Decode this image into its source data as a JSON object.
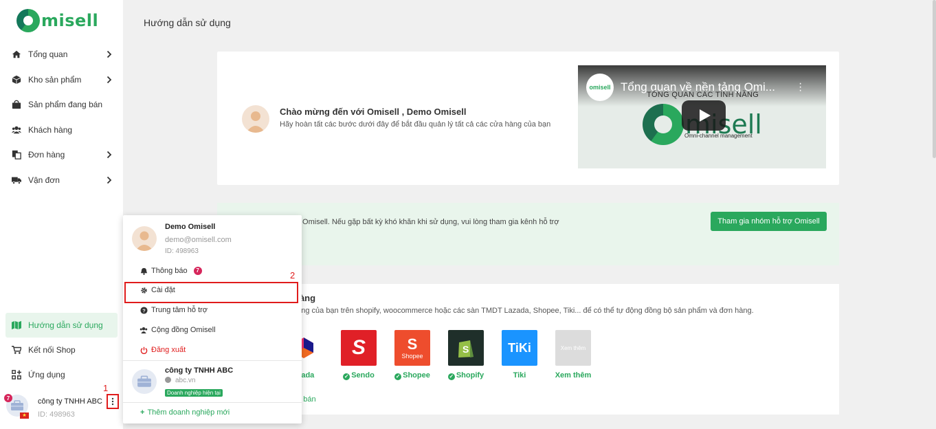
{
  "brand": {
    "logo_text": "misell",
    "accent": "#2aa85d"
  },
  "sidebar": {
    "items": [
      {
        "label": "Tổng quan",
        "icon": "home-icon",
        "has_submenu": true
      },
      {
        "label": "Kho sản phẩm",
        "icon": "box-icon",
        "has_submenu": true
      },
      {
        "label": "Sản phẩm đang bán",
        "icon": "bag-icon",
        "has_submenu": false
      },
      {
        "label": "Khách hàng",
        "icon": "users-icon",
        "has_submenu": false
      },
      {
        "label": "Đơn hàng",
        "icon": "orders-icon",
        "has_submenu": true
      },
      {
        "label": "Vận đơn",
        "icon": "truck-icon",
        "has_submenu": true
      }
    ],
    "bottom_items": [
      {
        "label": "Hướng dẫn sử dụng",
        "icon": "map-icon",
        "active": true
      },
      {
        "label": "Kết nối Shop",
        "icon": "cart-icon",
        "active": false
      },
      {
        "label": "Ứng dụng",
        "icon": "apps-icon",
        "active": false
      }
    ],
    "company": {
      "name": "công ty TNHH ABC",
      "id_text": "ID: 498963",
      "notification_count": "7",
      "flag": "★"
    },
    "marker": "1"
  },
  "main": {
    "page_title": "Hướng dẫn sử dụng",
    "welcome": {
      "title": "Chào mừng đến với Omisell , Demo Omisell",
      "subtitle": "Hãy hoàn tất các bước dưới đây để bắt đầu quản lý tất cả các cửa hàng của bạn"
    },
    "video": {
      "channel": "omisell",
      "title": "Tổng quan về nền tảng Omi...",
      "subtitle": "TỔNG QUAN CÁC TÍNH NĂNG",
      "logo_text": "misell",
      "tagline": "Omni-channel management"
    },
    "support": {
      "text": "ký Omisell. Nếu gặp bất kỳ khó khăn khi sử dụng, vui lòng tham gia kênh hỗ trợ",
      "button": "Tham gia nhóm hỗ trợ Omisell"
    },
    "connect": {
      "title": "hàng",
      "subtitle": "hàng của bạn trên shopify, woocommerce hoặc các sàn TMDT Lazada, Shopee, Tiki... để có thể tự động đồng bộ sản phẩm và đơn hàng.",
      "channels": [
        {
          "label": "azada",
          "checked": false,
          "color": "#1a1a8c"
        },
        {
          "label": "Sendo",
          "checked": true,
          "color": "#e02027"
        },
        {
          "label": "Shopee",
          "checked": true,
          "color": "#ee4d2d"
        },
        {
          "label": "Shopify",
          "checked": true,
          "color": "#1f2f2a"
        },
        {
          "label": "Tiki",
          "checked": false,
          "color": "#1a94ff"
        },
        {
          "label": "Xem thêm",
          "checked": false,
          "color": "#dcdcdc"
        }
      ],
      "shopee_tile_text": "Shopee",
      "tiki_tile_text": "TiKi",
      "more_tile_text": "Xem thêm",
      "link": "nh bán"
    }
  },
  "dropdown": {
    "user_name": "Demo Omisell",
    "email": "demo@omisell.com",
    "id_text": "ID: 498963",
    "items": [
      {
        "label": "Thông báo",
        "icon": "bell-icon",
        "badge": "7"
      },
      {
        "label": "Cài đặt",
        "icon": "gear-icon"
      },
      {
        "label": "Trung tâm hỗ trợ",
        "icon": "help-icon"
      },
      {
        "label": "Cộng đồng Omisell",
        "icon": "community-icon"
      },
      {
        "label": "Đăng xuất",
        "icon": "power-icon"
      }
    ],
    "company_name": "công ty TNHH ABC",
    "company_site": "abc.vn",
    "company_tag": "Doanh nghiệp hiện tại",
    "add_company": "Thêm doanh nghiệp mới",
    "marker": "2"
  }
}
